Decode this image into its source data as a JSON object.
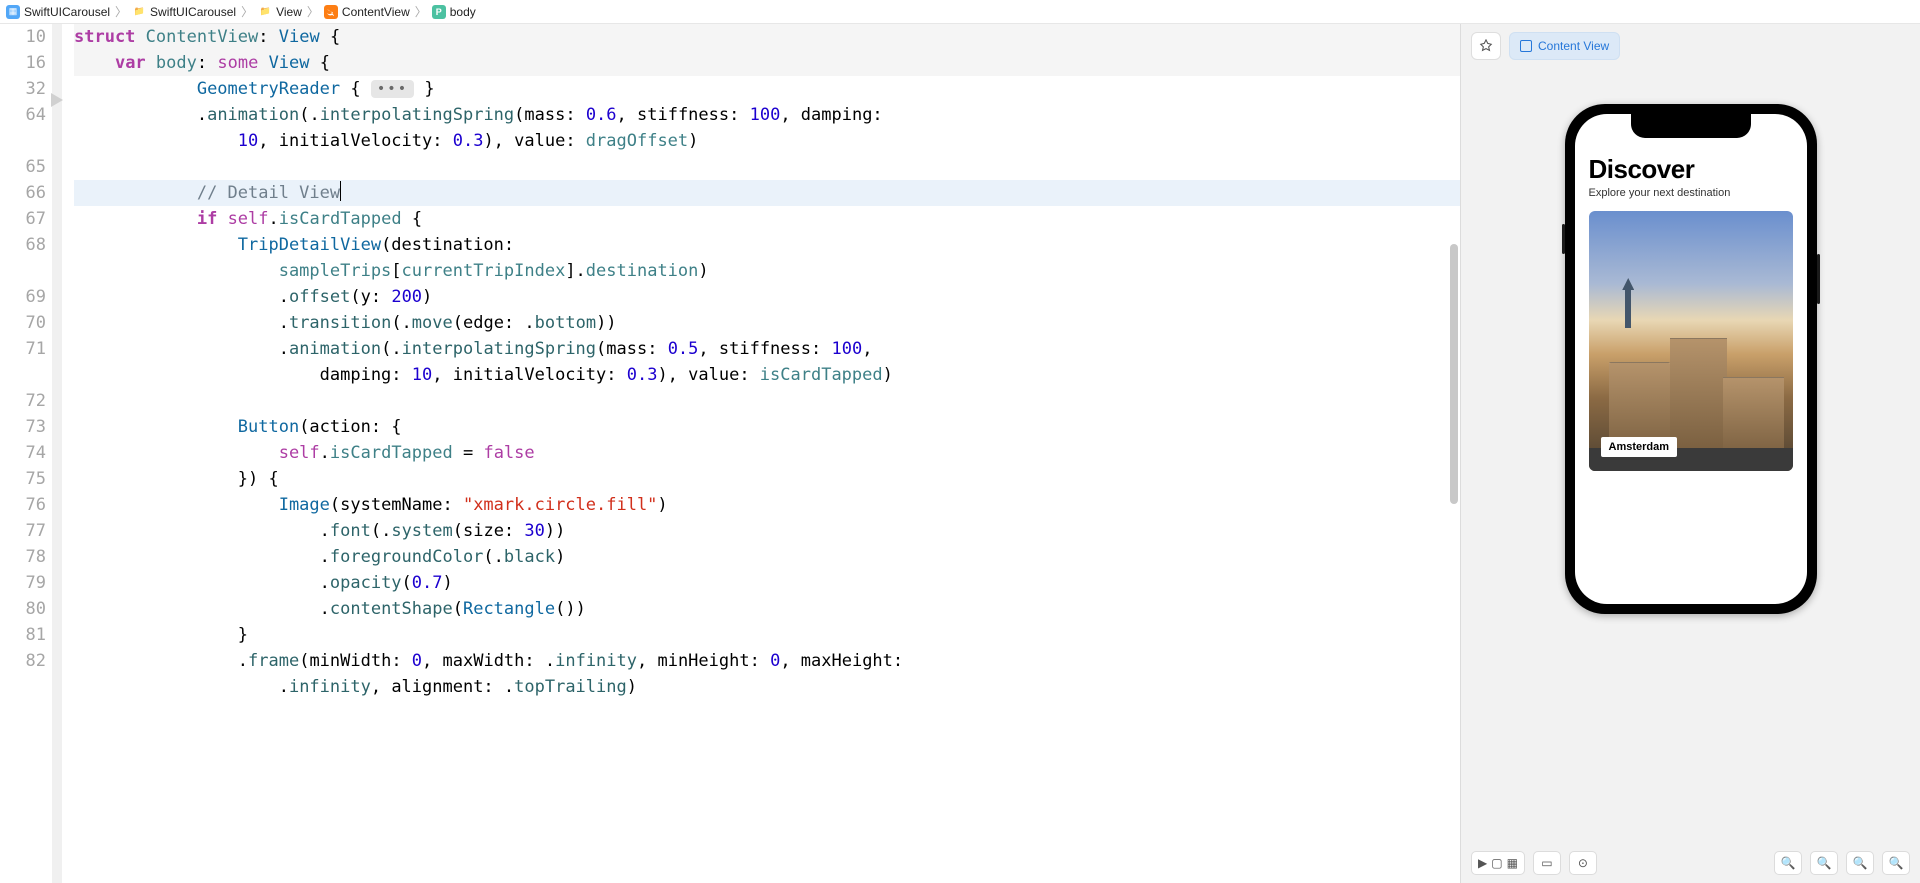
{
  "breadcrumb": {
    "project": "SwiftUICarousel",
    "group": "SwiftUICarousel",
    "folder": "View",
    "file": "ContentView",
    "symbol": "body"
  },
  "editor": {
    "line_numbers": [
      "10",
      "16",
      "32",
      "64",
      " ",
      "65",
      "66",
      "67",
      "68",
      " ",
      "69",
      "70",
      "71",
      " ",
      "72",
      "73",
      "74",
      "75",
      "76",
      "77",
      "78",
      "79",
      "80",
      "81",
      "82",
      " ",
      " "
    ],
    "lines": [
      {
        "cls": "hl-decl",
        "indent": 0,
        "tokens": [
          {
            "c": "kw",
            "t": "struct"
          },
          {
            "c": "plain",
            "t": " "
          },
          {
            "c": "typeL",
            "t": "ContentView"
          },
          {
            "c": "plain",
            "t": ": "
          },
          {
            "c": "type",
            "t": "View"
          },
          {
            "c": "plain",
            "t": " {"
          }
        ]
      },
      {
        "cls": "hl-decl",
        "indent": 1,
        "tokens": [
          {
            "c": "kw",
            "t": "var"
          },
          {
            "c": "plain",
            "t": " "
          },
          {
            "c": "typeL",
            "t": "body"
          },
          {
            "c": "plain",
            "t": ": "
          },
          {
            "c": "kw2",
            "t": "some"
          },
          {
            "c": "plain",
            "t": " "
          },
          {
            "c": "type",
            "t": "View"
          },
          {
            "c": "plain",
            "t": " {"
          }
        ]
      },
      {
        "cls": "",
        "indent": 3,
        "tokens": [
          {
            "c": "type",
            "t": "GeometryReader"
          },
          {
            "c": "plain",
            "t": " { "
          },
          {
            "c": "fold",
            "t": "•••"
          },
          {
            "c": "plain",
            "t": " }"
          }
        ]
      },
      {
        "cls": "",
        "indent": 3,
        "tokens": [
          {
            "c": "plain",
            "t": "."
          },
          {
            "c": "dot",
            "t": "animation"
          },
          {
            "c": "plain",
            "t": "(."
          },
          {
            "c": "dot",
            "t": "interpolatingSpring"
          },
          {
            "c": "plain",
            "t": "(mass: "
          },
          {
            "c": "num",
            "t": "0.6"
          },
          {
            "c": "plain",
            "t": ", stiffness: "
          },
          {
            "c": "num",
            "t": "100"
          },
          {
            "c": "plain",
            "t": ", damping:"
          }
        ]
      },
      {
        "cls": "",
        "indent": 4,
        "tokens": [
          {
            "c": "num",
            "t": "10"
          },
          {
            "c": "plain",
            "t": ", initialVelocity: "
          },
          {
            "c": "num",
            "t": "0.3"
          },
          {
            "c": "plain",
            "t": "), value: "
          },
          {
            "c": "typeL",
            "t": "dragOffset"
          },
          {
            "c": "plain",
            "t": ")"
          }
        ]
      },
      {
        "cls": "",
        "indent": 0,
        "tokens": []
      },
      {
        "cls": "cur",
        "indent": 3,
        "tokens": [
          {
            "c": "com",
            "t": "// Detail View"
          }
        ]
      },
      {
        "cls": "",
        "indent": 3,
        "tokens": [
          {
            "c": "kw",
            "t": "if"
          },
          {
            "c": "plain",
            "t": " "
          },
          {
            "c": "kw2",
            "t": "self"
          },
          {
            "c": "plain",
            "t": "."
          },
          {
            "c": "typeL",
            "t": "isCardTapped"
          },
          {
            "c": "plain",
            "t": " {"
          }
        ]
      },
      {
        "cls": "",
        "indent": 4,
        "tokens": [
          {
            "c": "type",
            "t": "TripDetailView"
          },
          {
            "c": "plain",
            "t": "(destination:"
          }
        ]
      },
      {
        "cls": "",
        "indent": 5,
        "tokens": [
          {
            "c": "typeL",
            "t": "sampleTrips"
          },
          {
            "c": "plain",
            "t": "["
          },
          {
            "c": "typeL",
            "t": "currentTripIndex"
          },
          {
            "c": "plain",
            "t": "]."
          },
          {
            "c": "typeL",
            "t": "destination"
          },
          {
            "c": "plain",
            "t": ")"
          }
        ]
      },
      {
        "cls": "",
        "indent": 5,
        "tokens": [
          {
            "c": "plain",
            "t": "."
          },
          {
            "c": "dot",
            "t": "offset"
          },
          {
            "c": "plain",
            "t": "(y: "
          },
          {
            "c": "num",
            "t": "200"
          },
          {
            "c": "plain",
            "t": ")"
          }
        ]
      },
      {
        "cls": "",
        "indent": 5,
        "tokens": [
          {
            "c": "plain",
            "t": "."
          },
          {
            "c": "dot",
            "t": "transition"
          },
          {
            "c": "plain",
            "t": "(."
          },
          {
            "c": "dot",
            "t": "move"
          },
          {
            "c": "plain",
            "t": "(edge: ."
          },
          {
            "c": "dot",
            "t": "bottom"
          },
          {
            "c": "plain",
            "t": "))"
          }
        ]
      },
      {
        "cls": "",
        "indent": 5,
        "tokens": [
          {
            "c": "plain",
            "t": "."
          },
          {
            "c": "dot",
            "t": "animation"
          },
          {
            "c": "plain",
            "t": "(."
          },
          {
            "c": "dot",
            "t": "interpolatingSpring"
          },
          {
            "c": "plain",
            "t": "(mass: "
          },
          {
            "c": "num",
            "t": "0.5"
          },
          {
            "c": "plain",
            "t": ", stiffness: "
          },
          {
            "c": "num",
            "t": "100"
          },
          {
            "c": "plain",
            "t": ","
          }
        ]
      },
      {
        "cls": "",
        "indent": 6,
        "tokens": [
          {
            "c": "plain",
            "t": "damping: "
          },
          {
            "c": "num",
            "t": "10"
          },
          {
            "c": "plain",
            "t": ", initialVelocity: "
          },
          {
            "c": "num",
            "t": "0.3"
          },
          {
            "c": "plain",
            "t": "), value: "
          },
          {
            "c": "typeL",
            "t": "isCardTapped"
          },
          {
            "c": "plain",
            "t": ")"
          }
        ]
      },
      {
        "cls": "",
        "indent": 0,
        "tokens": []
      },
      {
        "cls": "",
        "indent": 4,
        "tokens": [
          {
            "c": "type",
            "t": "Button"
          },
          {
            "c": "plain",
            "t": "(action: {"
          }
        ]
      },
      {
        "cls": "",
        "indent": 5,
        "tokens": [
          {
            "c": "kw2",
            "t": "self"
          },
          {
            "c": "plain",
            "t": "."
          },
          {
            "c": "typeL",
            "t": "isCardTapped"
          },
          {
            "c": "plain",
            "t": " = "
          },
          {
            "c": "kw2",
            "t": "false"
          }
        ]
      },
      {
        "cls": "",
        "indent": 4,
        "tokens": [
          {
            "c": "plain",
            "t": "}) {"
          }
        ]
      },
      {
        "cls": "",
        "indent": 5,
        "tokens": [
          {
            "c": "type",
            "t": "Image"
          },
          {
            "c": "plain",
            "t": "(systemName: "
          },
          {
            "c": "str",
            "t": "\"xmark.circle.fill\""
          },
          {
            "c": "plain",
            "t": ")"
          }
        ]
      },
      {
        "cls": "",
        "indent": 6,
        "tokens": [
          {
            "c": "plain",
            "t": "."
          },
          {
            "c": "dot",
            "t": "font"
          },
          {
            "c": "plain",
            "t": "(."
          },
          {
            "c": "dot",
            "t": "system"
          },
          {
            "c": "plain",
            "t": "(size: "
          },
          {
            "c": "num",
            "t": "30"
          },
          {
            "c": "plain",
            "t": "))"
          }
        ]
      },
      {
        "cls": "",
        "indent": 6,
        "tokens": [
          {
            "c": "plain",
            "t": "."
          },
          {
            "c": "dot",
            "t": "foregroundColor"
          },
          {
            "c": "plain",
            "t": "(."
          },
          {
            "c": "dot",
            "t": "black"
          },
          {
            "c": "plain",
            "t": ")"
          }
        ]
      },
      {
        "cls": "",
        "indent": 6,
        "tokens": [
          {
            "c": "plain",
            "t": "."
          },
          {
            "c": "dot",
            "t": "opacity"
          },
          {
            "c": "plain",
            "t": "("
          },
          {
            "c": "num",
            "t": "0.7"
          },
          {
            "c": "plain",
            "t": ")"
          }
        ]
      },
      {
        "cls": "",
        "indent": 6,
        "tokens": [
          {
            "c": "plain",
            "t": "."
          },
          {
            "c": "dot",
            "t": "contentShape"
          },
          {
            "c": "plain",
            "t": "("
          },
          {
            "c": "type",
            "t": "Rectangle"
          },
          {
            "c": "plain",
            "t": "())"
          }
        ]
      },
      {
        "cls": "",
        "indent": 4,
        "tokens": [
          {
            "c": "plain",
            "t": "}"
          }
        ]
      },
      {
        "cls": "",
        "indent": 4,
        "tokens": [
          {
            "c": "plain",
            "t": "."
          },
          {
            "c": "dot",
            "t": "frame"
          },
          {
            "c": "plain",
            "t": "(minWidth: "
          },
          {
            "c": "num",
            "t": "0"
          },
          {
            "c": "plain",
            "t": ", maxWidth: ."
          },
          {
            "c": "dot",
            "t": "infinity"
          },
          {
            "c": "plain",
            "t": ", minHeight: "
          },
          {
            "c": "num",
            "t": "0"
          },
          {
            "c": "plain",
            "t": ", maxHeight:"
          }
        ]
      },
      {
        "cls": "",
        "indent": 5,
        "tokens": [
          {
            "c": "plain",
            "t": "."
          },
          {
            "c": "dot",
            "t": "infinity"
          },
          {
            "c": "plain",
            "t": ", alignment: ."
          },
          {
            "c": "dot",
            "t": "topTrailing"
          },
          {
            "c": "plain",
            "t": ")"
          }
        ]
      },
      {
        "cls": "",
        "indent": 4,
        "tokens": [
          {
            "c": "plain",
            "t": ""
          }
        ]
      }
    ]
  },
  "canvas": {
    "pill_label": "Content View",
    "app": {
      "title": "Discover",
      "subtitle": "Explore your next destination",
      "card_label": "Amsterdam"
    }
  }
}
